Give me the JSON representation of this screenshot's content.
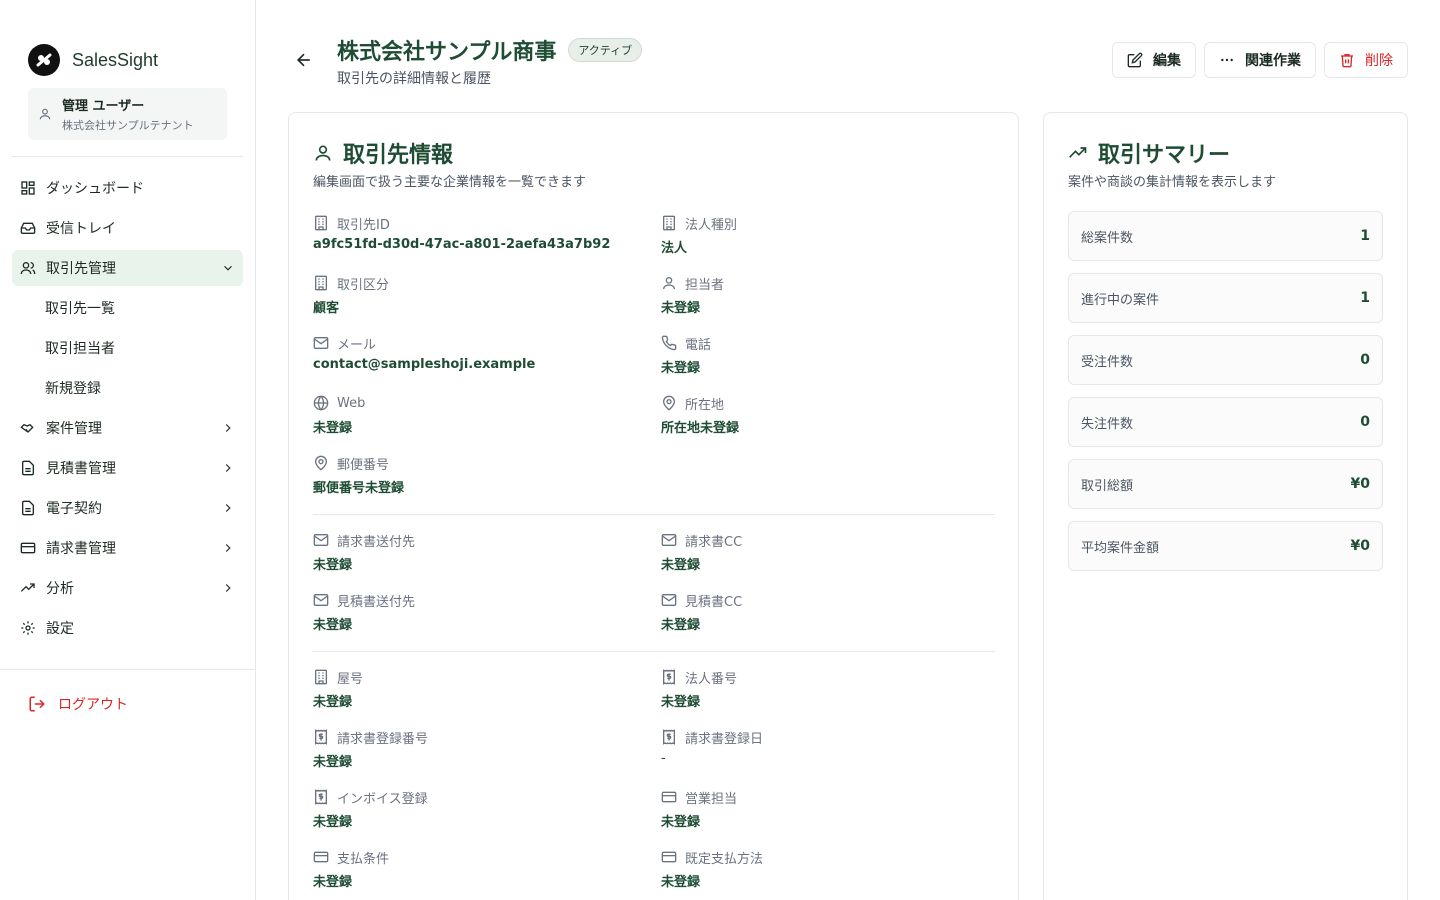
{
  "brand": {
    "name": "SalesSight"
  },
  "user": {
    "name": "管理 ユーザー",
    "tenant": "株式会社サンプルテナント"
  },
  "nav": {
    "items": [
      {
        "label": "ダッシュボード"
      },
      {
        "label": "受信トレイ"
      },
      {
        "label": "取引先管理"
      },
      {
        "label": "案件管理"
      },
      {
        "label": "見積書管理"
      },
      {
        "label": "電子契約"
      },
      {
        "label": "請求書管理"
      },
      {
        "label": "分析"
      },
      {
        "label": "設定"
      }
    ],
    "subitems": [
      {
        "label": "取引先一覧"
      },
      {
        "label": "取引担当者"
      },
      {
        "label": "新規登録"
      }
    ],
    "logout": "ログアウト"
  },
  "header": {
    "title": "株式会社サンプル商事",
    "status": "アクティブ",
    "subtitle": "取引先の詳細情報と履歴",
    "edit_label": "編集",
    "related_label": "関連作業",
    "delete_label": "削除"
  },
  "info": {
    "title": "取引先情報",
    "description": "編集画面で扱う主要な企業情報を一覧できます",
    "fields": [
      {
        "label": "取引先ID",
        "value": "a9fc51fd-d30d-47ac-a801-2aefa43a7b92"
      },
      {
        "label": "法人種別",
        "value": "法人"
      },
      {
        "label": "取引区分",
        "value": "顧客"
      },
      {
        "label": "担当者",
        "value": "未登録"
      },
      {
        "label": "メール",
        "value": "contact@sampleshoji.example"
      },
      {
        "label": "電話",
        "value": "未登録"
      },
      {
        "label": "Web",
        "value": "未登録"
      },
      {
        "label": "所在地",
        "value": "所在地未登録"
      },
      {
        "label": "郵便番号",
        "value": "郵便番号未登録"
      },
      {
        "label": "請求書送付先",
        "value": "未登録"
      },
      {
        "label": "請求書CC",
        "value": "未登録"
      },
      {
        "label": "見積書送付先",
        "value": "未登録"
      },
      {
        "label": "見積書CC",
        "value": "未登録"
      },
      {
        "label": "屋号",
        "value": "未登録"
      },
      {
        "label": "法人番号",
        "value": "未登録"
      },
      {
        "label": "請求書登録番号",
        "value": "未登録"
      },
      {
        "label": "請求書登録日",
        "value": "-"
      },
      {
        "label": "インボイス登録",
        "value": "未登録"
      },
      {
        "label": "営業担当",
        "value": "未登録"
      },
      {
        "label": "支払条件",
        "value": "未登録"
      },
      {
        "label": "既定支払方法",
        "value": "未登録"
      }
    ]
  },
  "summary": {
    "title": "取引サマリー",
    "description": "案件や商談の集計情報を表示します",
    "rows": [
      {
        "label": "総案件数",
        "value": "1"
      },
      {
        "label": "進行中の案件",
        "value": "1"
      },
      {
        "label": "受注件数",
        "value": "0"
      },
      {
        "label": "失注件数",
        "value": "0"
      },
      {
        "label": "取引総額",
        "value": "¥0"
      },
      {
        "label": "平均案件金額",
        "value": "¥0"
      }
    ]
  }
}
